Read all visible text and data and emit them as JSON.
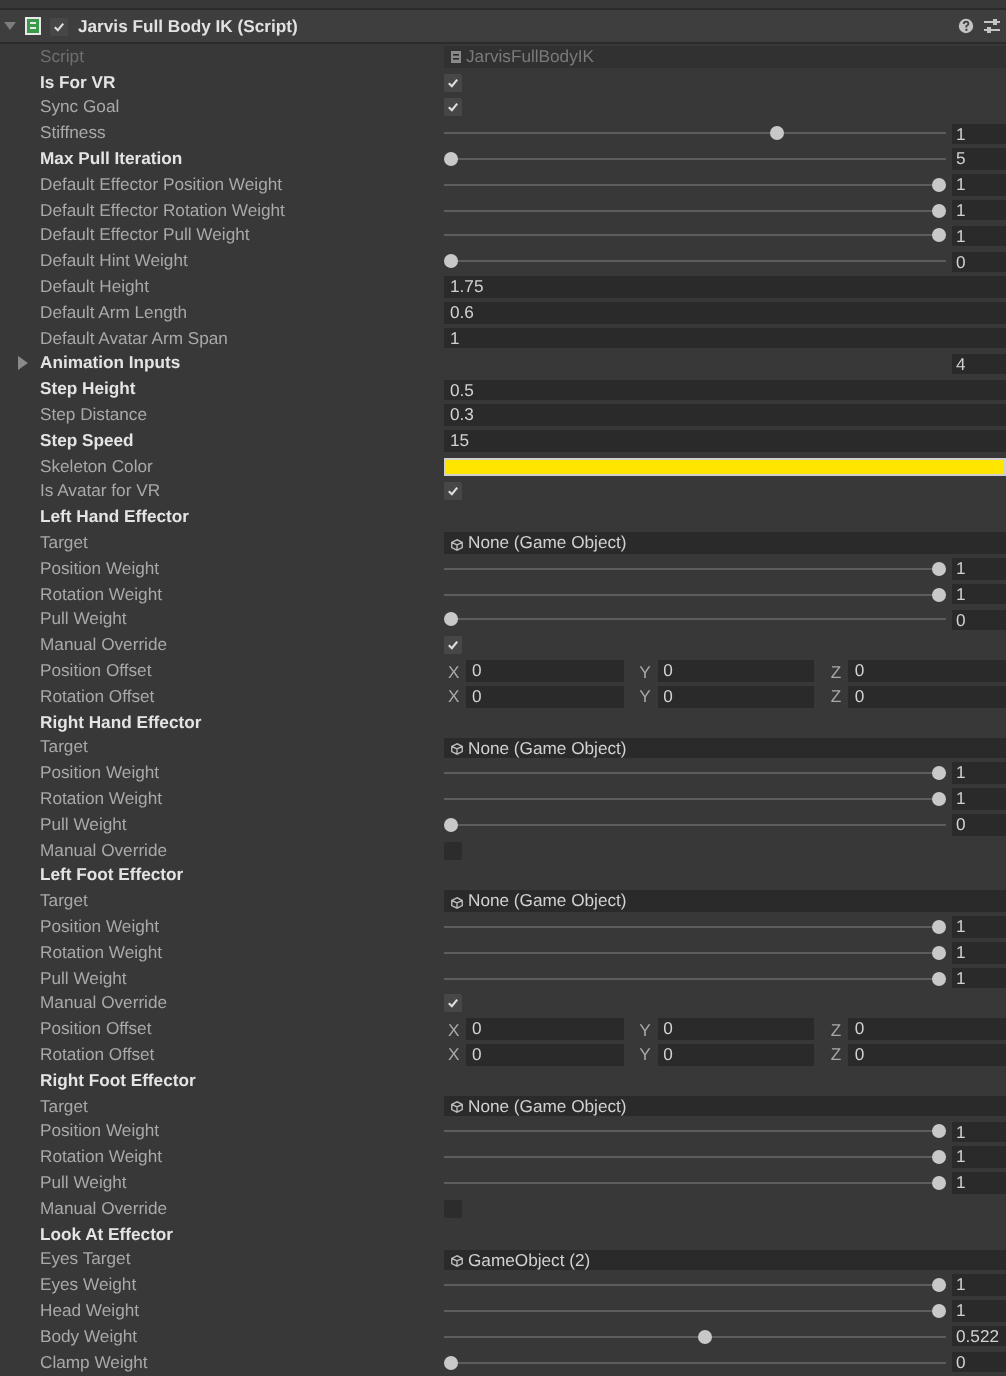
{
  "component": {
    "title": "Jarvis Full Body IK (Script)",
    "enabled": true,
    "expanded": true
  },
  "rows": [
    {
      "kind": "script",
      "label": "Script",
      "value": "JarvisFullBodyIK",
      "disabled": true
    },
    {
      "kind": "check",
      "label": "Is For VR",
      "checked": true,
      "modified": true
    },
    {
      "kind": "check",
      "label": "Sync Goal",
      "checked": true,
      "modified": false
    },
    {
      "kind": "slider",
      "label": "Stiffness",
      "level": 0.67,
      "value": "1",
      "modified": false
    },
    {
      "kind": "slider",
      "label": "Max Pull Iteration",
      "level": 0,
      "value": "5",
      "modified": true
    },
    {
      "kind": "slider",
      "label": "Default Effector Position Weight",
      "level": 1,
      "value": "1",
      "modified": false
    },
    {
      "kind": "slider",
      "label": "Default Effector Rotation Weight",
      "level": 1,
      "value": "1",
      "modified": false
    },
    {
      "kind": "slider",
      "label": "Default Effector Pull Weight",
      "level": 1,
      "value": "1",
      "modified": false
    },
    {
      "kind": "slider",
      "label": "Default Hint Weight",
      "level": 0,
      "value": "0",
      "modified": false
    },
    {
      "kind": "float",
      "label": "Default Height",
      "value": "1.75",
      "modified": false
    },
    {
      "kind": "float",
      "label": "Default Arm Length",
      "value": "0.6",
      "modified": false
    },
    {
      "kind": "float",
      "label": "Default Avatar Arm Span",
      "value": "1",
      "modified": false
    },
    {
      "kind": "foldout",
      "label": "Animation Inputs",
      "value": "4",
      "expanded": false,
      "modified": true
    },
    {
      "kind": "float",
      "label": "Step Height",
      "value": "0.5",
      "modified": true
    },
    {
      "kind": "float",
      "label": "Step Distance",
      "value": "0.3",
      "modified": false
    },
    {
      "kind": "float",
      "label": "Step Speed",
      "value": "15",
      "modified": true
    },
    {
      "kind": "color",
      "label": "Skeleton Color",
      "color": "#ffe600",
      "modified": false
    },
    {
      "kind": "check",
      "label": "Is Avatar for VR",
      "checked": true,
      "modified": false
    },
    {
      "kind": "header",
      "label": "Left Hand Effector"
    },
    {
      "kind": "object",
      "label": "Target",
      "value": "None (Game Object)",
      "disabled": false,
      "modified": false
    },
    {
      "kind": "slider",
      "label": "Position Weight",
      "level": 1,
      "value": "1",
      "modified": false
    },
    {
      "kind": "slider",
      "label": "Rotation Weight",
      "level": 1,
      "value": "1",
      "modified": false
    },
    {
      "kind": "slider",
      "label": "Pull Weight",
      "level": 0,
      "value": "0",
      "modified": false
    },
    {
      "kind": "check",
      "label": "Manual Override",
      "checked": true,
      "modified": false
    },
    {
      "kind": "vector",
      "label": "Position Offset",
      "components": [
        {
          "axis": "X",
          "value": "0"
        },
        {
          "axis": "Y",
          "value": "0"
        },
        {
          "axis": "Z",
          "value": "0"
        }
      ],
      "modified": false
    },
    {
      "kind": "vector",
      "label": "Rotation Offset",
      "components": [
        {
          "axis": "X",
          "value": "0"
        },
        {
          "axis": "Y",
          "value": "0"
        },
        {
          "axis": "Z",
          "value": "0"
        }
      ],
      "modified": false
    },
    {
      "kind": "header",
      "label": "Right Hand Effector"
    },
    {
      "kind": "object",
      "label": "Target",
      "value": "None (Game Object)",
      "disabled": false,
      "modified": false
    },
    {
      "kind": "slider",
      "label": "Position Weight",
      "level": 1,
      "value": "1",
      "modified": false
    },
    {
      "kind": "slider",
      "label": "Rotation Weight",
      "level": 1,
      "value": "1",
      "modified": false
    },
    {
      "kind": "slider",
      "label": "Pull Weight",
      "level": 0,
      "value": "0",
      "modified": false
    },
    {
      "kind": "check",
      "label": "Manual Override",
      "checked": false,
      "modified": false
    },
    {
      "kind": "header",
      "label": "Left Foot Effector"
    },
    {
      "kind": "object",
      "label": "Target",
      "value": "None (Game Object)",
      "disabled": false,
      "modified": false
    },
    {
      "kind": "slider",
      "label": "Position Weight",
      "level": 1,
      "value": "1",
      "modified": false
    },
    {
      "kind": "slider",
      "label": "Rotation Weight",
      "level": 1,
      "value": "1",
      "modified": false
    },
    {
      "kind": "slider",
      "label": "Pull Weight",
      "level": 1,
      "value": "1",
      "modified": false
    },
    {
      "kind": "check",
      "label": "Manual Override",
      "checked": true,
      "modified": false
    },
    {
      "kind": "vector",
      "label": "Position Offset",
      "components": [
        {
          "axis": "X",
          "value": "0"
        },
        {
          "axis": "Y",
          "value": "0"
        },
        {
          "axis": "Z",
          "value": "0"
        }
      ],
      "modified": false
    },
    {
      "kind": "vector",
      "label": "Rotation Offset",
      "components": [
        {
          "axis": "X",
          "value": "0"
        },
        {
          "axis": "Y",
          "value": "0"
        },
        {
          "axis": "Z",
          "value": "0"
        }
      ],
      "modified": false
    },
    {
      "kind": "header",
      "label": "Right Foot Effector"
    },
    {
      "kind": "object",
      "label": "Target",
      "value": "None (Game Object)",
      "disabled": false,
      "modified": false
    },
    {
      "kind": "slider",
      "label": "Position Weight",
      "level": 1,
      "value": "1",
      "modified": false
    },
    {
      "kind": "slider",
      "label": "Rotation Weight",
      "level": 1,
      "value": "1",
      "modified": false
    },
    {
      "kind": "slider",
      "label": "Pull Weight",
      "level": 1,
      "value": "1",
      "modified": false
    },
    {
      "kind": "check",
      "label": "Manual Override",
      "checked": false,
      "modified": false
    },
    {
      "kind": "header",
      "label": "Look At Effector"
    },
    {
      "kind": "object",
      "label": "Eyes Target",
      "value": "GameObject (2)",
      "disabled": false,
      "modified": false
    },
    {
      "kind": "slider",
      "label": "Eyes Weight",
      "level": 1,
      "value": "1",
      "modified": false
    },
    {
      "kind": "slider",
      "label": "Head Weight",
      "level": 1,
      "value": "1",
      "modified": false
    },
    {
      "kind": "slider",
      "label": "Body Weight",
      "level": 0.52,
      "value": "0.522",
      "modified": false
    },
    {
      "kind": "slider",
      "label": "Clamp Weight",
      "level": 0,
      "value": "0",
      "modified": false
    }
  ]
}
